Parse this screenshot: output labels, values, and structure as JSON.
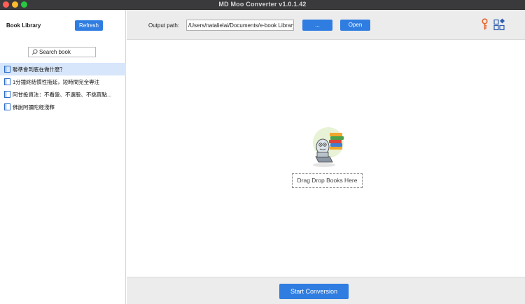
{
  "window": {
    "title": "MD Moo Converter v1.0.1.42"
  },
  "sidebar": {
    "title": "Book Library",
    "refresh_label": "Refresh",
    "search_placeholder": "Search book",
    "books": [
      {
        "label": "聯準會到底在做什麼？",
        "selected": true
      },
      {
        "label": "1分鐘終結慣性拖延，短時間完全專注",
        "selected": false
      },
      {
        "label": "阿甘投資法：不看盤、不選股、不挑買點...",
        "selected": false
      },
      {
        "label": "佛說阿彌陀經淺釋",
        "selected": false
      }
    ]
  },
  "toolbar": {
    "output_label": "Output path:",
    "output_path": "/Users/natalielai/Documents/e-book Library",
    "browse_label": "...",
    "open_label": "Open",
    "icons": [
      "key-icon",
      "apps-icon"
    ]
  },
  "drop_area": {
    "drop_label": "Drag Drop Books Here",
    "illustration": "reading-mascot-illustration"
  },
  "footer": {
    "start_label": "Start Conversion"
  },
  "colors": {
    "accent": "#2f7de1",
    "selected_row": "#d7e6fa",
    "key_orange": "#e8662c"
  }
}
